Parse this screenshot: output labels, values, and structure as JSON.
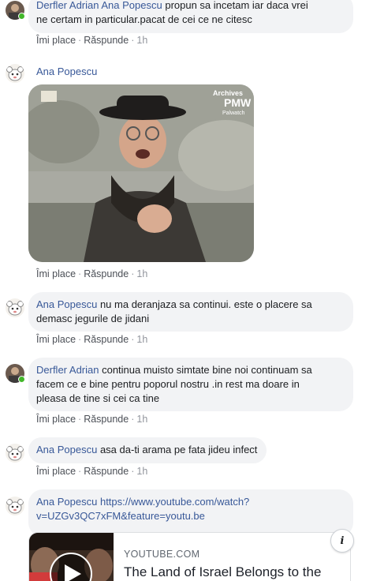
{
  "action_labels": {
    "like": "Îmi place",
    "reply": "Răspunde",
    "time": "1h",
    "separator": "·"
  },
  "comments": [
    {
      "author": "Derfler Adrian",
      "mention": "Ana Popescu",
      "line1_rest": " propun sa incetam iar daca vrei",
      "line2": "ne certam in particular.pacat de cei ce ne citesc"
    },
    {
      "author": "Ana Popescu",
      "gif_watermark_line1": "Archives",
      "gif_watermark_line2": "PMW",
      "gif_watermark_line3": "Palwatch"
    },
    {
      "author": "Ana Popescu",
      "line1_rest": " nu ma deranjaza sa continui. este o placere sa",
      "line2": "demasc jegurile de jidani"
    },
    {
      "author": "Derfler Adrian",
      "line1_rest": " continua muisto simtate bine noi continuam sa",
      "line2": "facem ce e bine pentru poporul nostru .in rest ma doare in",
      "line3": "pleasa de tine si cei ca tine"
    },
    {
      "author": "Ana Popescu",
      "line1_rest": " asa da-ti arama pe fata jideu infect"
    },
    {
      "author": "Ana Popescu",
      "link_line1": "https://www.youtube.com/watch?",
      "link_line2": "v=UZGv3QC7xFM&feature=youtu.be",
      "card": {
        "domain": "YOUTUBE.COM",
        "title": "The Land of Israel Belongs to the",
        "info_icon": "i"
      }
    }
  ],
  "colors": {
    "link": "#385898",
    "bubble": "#f2f3f5",
    "meta": "#90949c",
    "online": "#42b72a"
  }
}
